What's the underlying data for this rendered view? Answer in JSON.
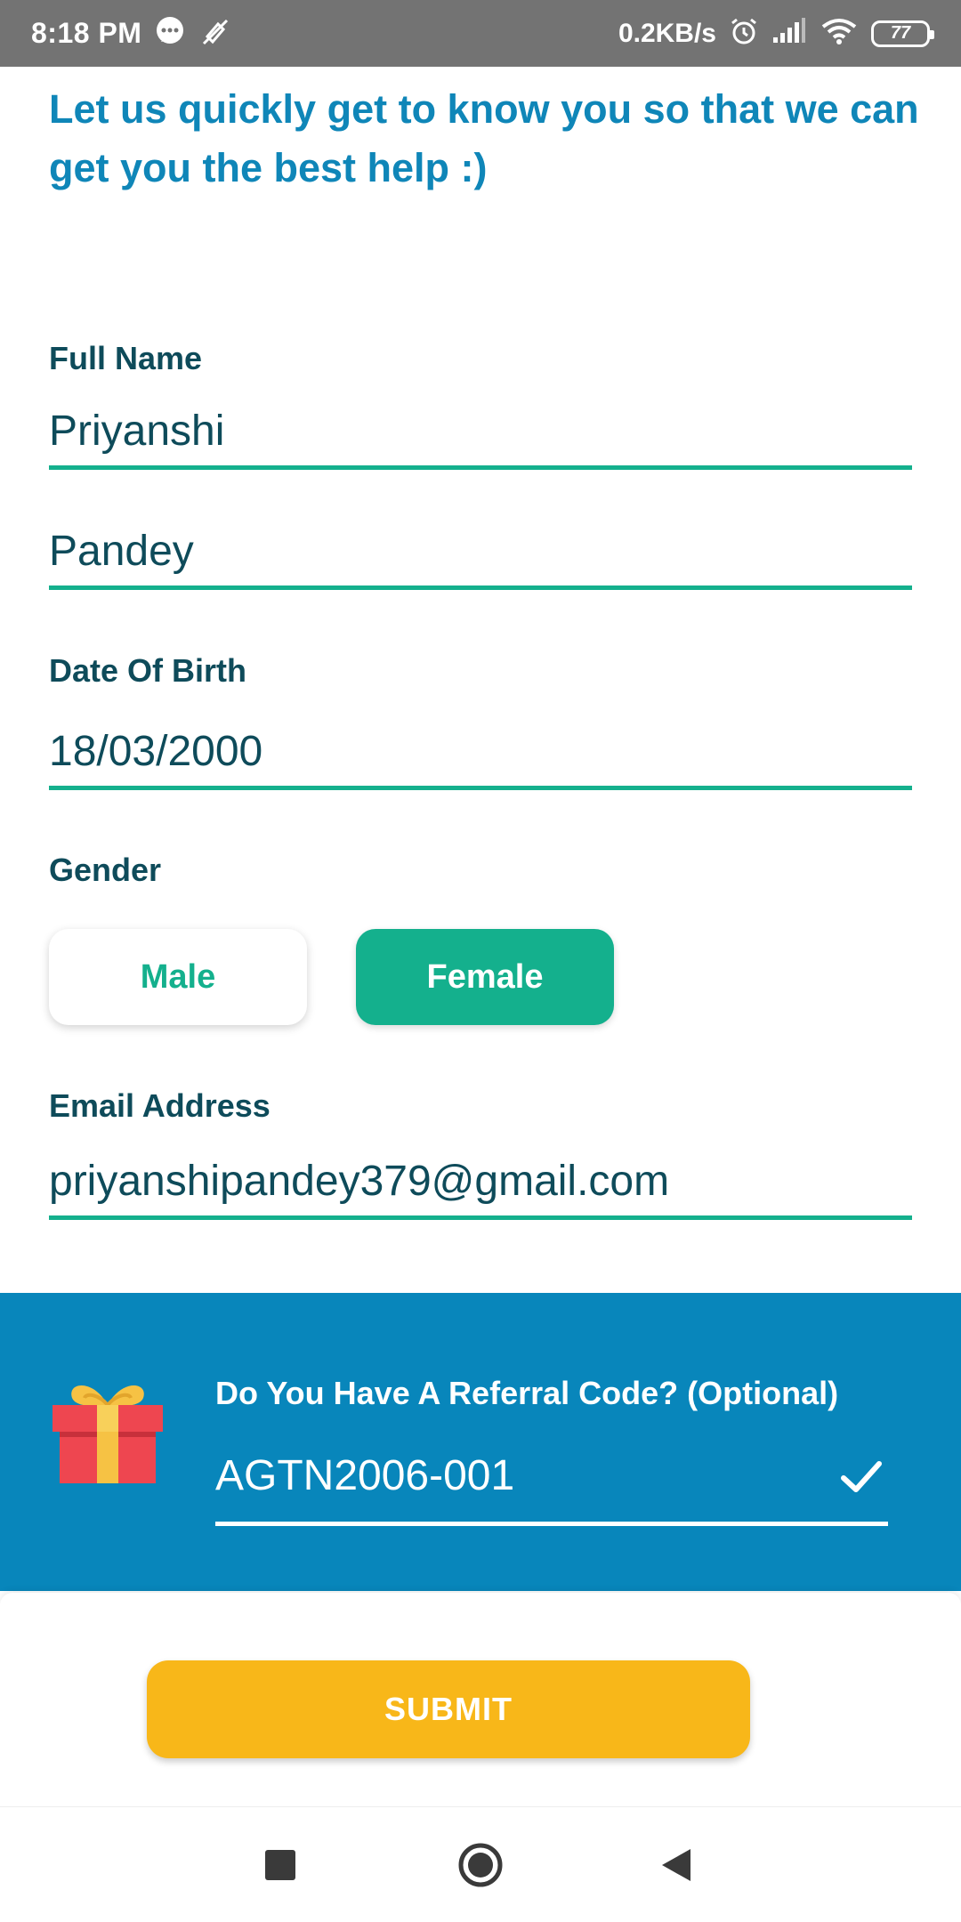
{
  "status_bar": {
    "time": "8:18 PM",
    "speed": "0.2KB/s",
    "battery": "77",
    "icons": [
      "chat-bubble-icon",
      "mute-icon",
      "alarm-icon",
      "signal-icon",
      "wifi-icon",
      "battery-icon"
    ]
  },
  "form": {
    "intro": "Let us quickly get to know you so that we can get you the best help :)",
    "full_name_label": "Full Name",
    "first_name": "Priyanshi",
    "last_name": "Pandey",
    "dob_label": "Date Of Birth",
    "dob": "18/03/2000",
    "gender_label": "Gender",
    "gender_options": [
      "Male",
      "Female"
    ],
    "gender_selected": "Female",
    "email_label": "Email Address",
    "email": "priyanshipandey379@gmail.com"
  },
  "referral": {
    "label": "Do You Have A Referral Code? (Optional)",
    "code": "AGTN2006-001",
    "icon": "gift-icon",
    "verified_icon": "check-icon"
  },
  "submit_label": "SUBMIT",
  "nav": [
    "recents-square-icon",
    "home-circle-icon",
    "back-triangle-icon"
  ],
  "colors": {
    "status_bar": "#737373",
    "primary_blue": "#0f86b8",
    "accent_green": "#14b08d",
    "text_dark": "#0e4b5a",
    "referral_bg": "#0886bb",
    "submit_bg": "#f8b719"
  }
}
